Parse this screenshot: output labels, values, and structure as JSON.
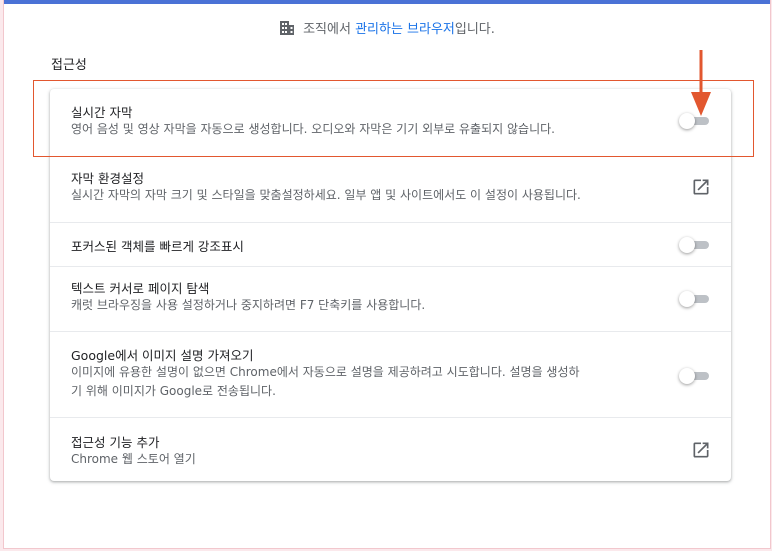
{
  "managed": {
    "prefix": "조직에서 ",
    "link": "관리하는 브라우저",
    "suffix": "입니다."
  },
  "section_title": "접근성",
  "items": [
    {
      "title": "실시간 자막",
      "desc": "영어 음성 및 영상 자막을 자동으로 생성합니다. 오디오와 자막은 기기 외부로 유출되지 않습니다.",
      "control": "toggle",
      "state": "off"
    },
    {
      "title": "자막 환경설정",
      "desc": "실시간 자막의 자막 크기 및 스타일을 맞춤설정하세요. 일부 앱 및 사이트에서도 이 설정이 사용됩니다.",
      "control": "external-link",
      "icon": "external-link-icon"
    },
    {
      "title": "포커스된 객체를 빠르게 강조표시",
      "desc": "",
      "control": "toggle",
      "state": "off"
    },
    {
      "title": "텍스트 커서로 페이지 탐색",
      "desc": "캐럿 브라우징을 사용 설정하거나 중지하려면 F7 단축키를 사용합니다.",
      "control": "toggle",
      "state": "off"
    },
    {
      "title": "Google에서 이미지 설명 가져오기",
      "desc_line1": "이미지에 유용한 설명이 없으면 Chrome에서 자동으로 설명을 제공하려고 시도합니다. 설명을 생성하",
      "desc_line2": "기 위해 이미지가 Google로 전송됩니다.",
      "control": "toggle",
      "state": "off"
    },
    {
      "title": "접근성 기능 추가",
      "desc": "Chrome 웹 스토어 열기",
      "control": "external-link",
      "icon": "external-link-icon"
    }
  ],
  "colors": {
    "accent": "#1a73e8",
    "highlight": "#e2572f",
    "topbar": "#4a72d6"
  },
  "icons": {
    "managed": "building-icon",
    "arrow": "down-arrow-annotation"
  }
}
